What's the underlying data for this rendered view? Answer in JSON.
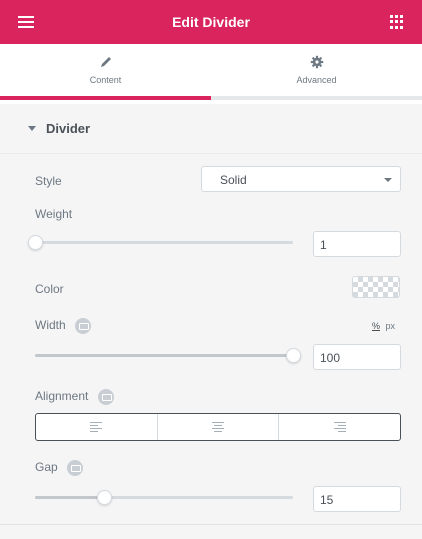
{
  "colors": {
    "accent": "#d9245d"
  },
  "header": {
    "title": "Edit Divider",
    "menu_icon": "hamburger-icon",
    "apps_icon": "grid-icon"
  },
  "tabs": [
    {
      "label": "Content",
      "icon": "pencil-icon",
      "active": true
    },
    {
      "label": "Advanced",
      "icon": "gear-icon",
      "active": false
    }
  ],
  "section": {
    "title": "Divider",
    "expanded": true
  },
  "controls": {
    "style": {
      "label": "Style",
      "value": "Solid"
    },
    "weight": {
      "label": "Weight",
      "value": "1",
      "slider_fraction": 0.0
    },
    "color": {
      "label": "Color"
    },
    "width": {
      "label": "Width",
      "value": "100",
      "unit_active": "%",
      "unit_other": "px",
      "slider_fraction": 1.0
    },
    "alignment": {
      "label": "Alignment",
      "options": [
        "left",
        "center",
        "right"
      ]
    },
    "gap": {
      "label": "Gap",
      "value": "15",
      "slider_fraction": 0.27
    }
  }
}
